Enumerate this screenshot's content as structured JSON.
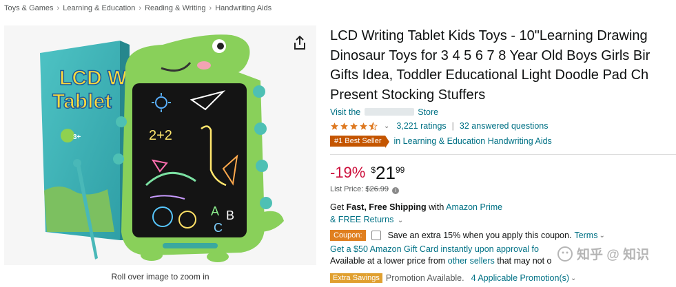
{
  "breadcrumb": [
    "Toys & Games",
    "Learning & Education",
    "Reading & Writing",
    "Handwriting Aids"
  ],
  "zoom_hint": "Roll over image to zoom in",
  "product": {
    "title_lines": [
      "LCD Writing Tablet Kids Toys - 10\"Learning Drawing",
      "Dinosaur Toys for 3 4 5 6 7 8 Year Old Boys Girls Bir",
      "Gifts Idea, Toddler Educational Light Doodle Pad Ch",
      "Present Stocking Stuffers"
    ],
    "store_prefix": "Visit the",
    "store_suffix": "Store",
    "rating": 4.5,
    "ratings_text": "3,221 ratings",
    "questions_text": "32 answered questions",
    "best_seller_badge": "#1 Best Seller",
    "best_seller_category": "in Learning & Education Handwriting Aids"
  },
  "box_art": {
    "line1": "LCD W",
    "line2": "Tablet",
    "age": "3+"
  },
  "price": {
    "discount": "-19%",
    "currency": "$",
    "whole": "21",
    "fraction": "99",
    "list_label": "List Price:",
    "list_value": "$26.99"
  },
  "shipping": {
    "prefix": "Get",
    "bold": "Fast, Free Shipping",
    "mid": "with",
    "link": "Amazon Prime",
    "returns": "& FREE Returns"
  },
  "coupon": {
    "badge": "Coupon:",
    "text": "Save an extra 15% when you apply this coupon.",
    "terms": "Terms"
  },
  "gift_card_text": "Get a $50 Amazon Gift Card instantly upon approval fo",
  "lower_price": {
    "prefix": "Available at a lower price from",
    "link": "other sellers",
    "suffix": "that may not o"
  },
  "savings": {
    "badge": "Extra Savings",
    "status": "Promotion Available.",
    "link": "4 Applicable Promotion(s)"
  },
  "watermark_text": "知乎 @ 知识"
}
